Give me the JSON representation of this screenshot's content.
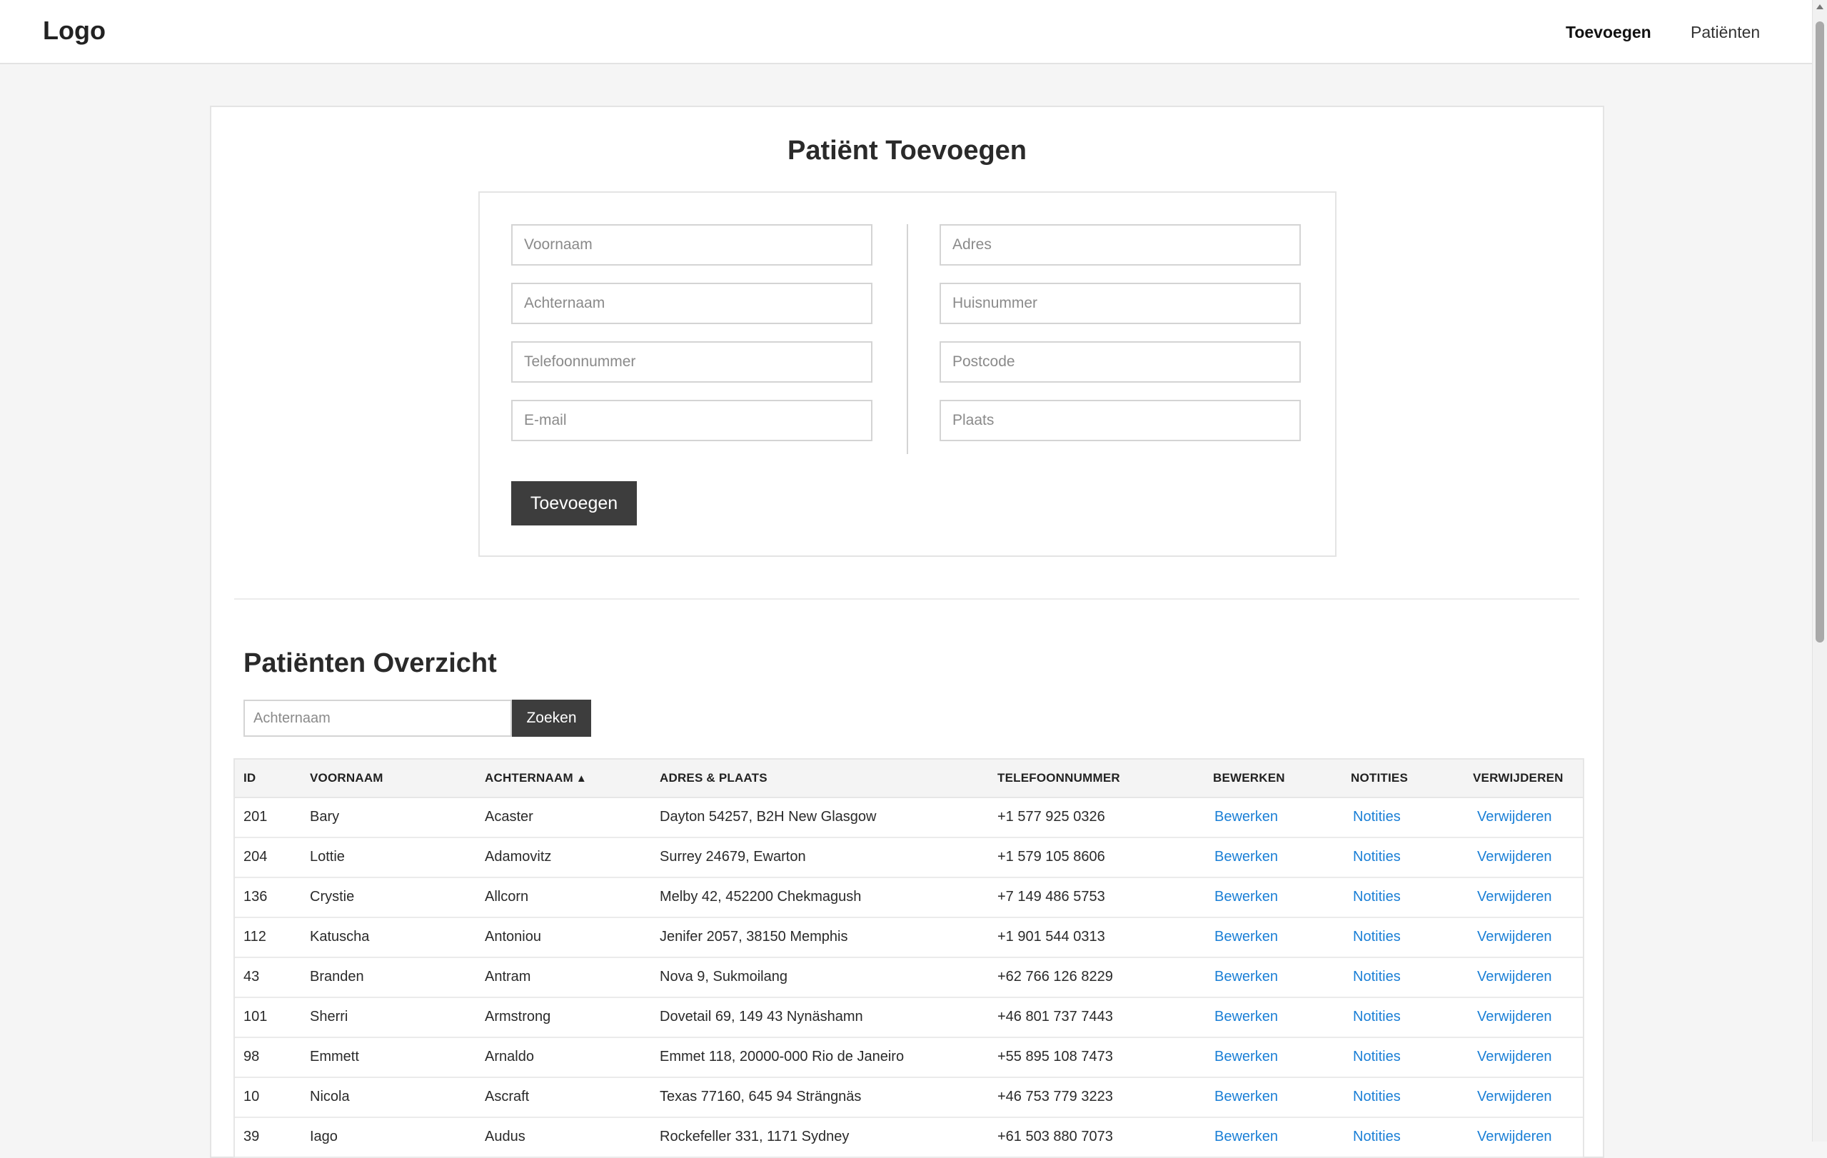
{
  "nav": {
    "logo": "Logo",
    "links": [
      "Toevoegen",
      "Patiënten"
    ]
  },
  "form": {
    "title": "Patiënt Toevoegen",
    "placeholders": {
      "first_name": "Voornaam",
      "last_name": "Achternaam",
      "phone": "Telefoonnummer",
      "email": "E-mail",
      "address": "Adres",
      "house_number": "Huisnummer",
      "postcode": "Postcode",
      "city": "Plaats"
    },
    "submit_label": "Toevoegen"
  },
  "overview": {
    "title": "Patiënten Overzicht",
    "search_placeholder": "Achternaam",
    "search_button": "Zoeken",
    "columns": [
      "ID",
      "VOORNAAM",
      "ACHTERNAAM",
      "ADRES & PLAATS",
      "TELEFOONNUMMER",
      "BEWERKEN",
      "NOTITIES",
      "VERWIJDEREN"
    ],
    "sort_indicator": "▲",
    "action_labels": {
      "edit": "Bewerken",
      "notes": "Notities",
      "delete": "Verwijderen"
    },
    "rows": [
      [
        "201",
        "Bary",
        "Acaster",
        "Dayton 54257, B2H New Glasgow",
        "+1 577 925 0326"
      ],
      [
        "204",
        "Lottie",
        "Adamovitz",
        "Surrey 24679, Ewarton",
        "+1 579 105 8606"
      ],
      [
        "136",
        "Crystie",
        "Allcorn",
        "Melby 42, 452200 Chekmagush",
        "+7 149 486 5753"
      ],
      [
        "112",
        "Katuscha",
        "Antoniou",
        "Jenifer 2057, 38150 Memphis",
        "+1 901 544 0313"
      ],
      [
        "43",
        "Branden",
        "Antram",
        "Nova 9, Sukmoilang",
        "+62 766 126 8229"
      ],
      [
        "101",
        "Sherri",
        "Armstrong",
        "Dovetail 69, 149 43 Nynäshamn",
        "+46 801 737 7443"
      ],
      [
        "98",
        "Emmett",
        "Arnaldo",
        "Emmet 118, 20000-000 Rio de Janeiro",
        "+55 895 108 7473"
      ],
      [
        "10",
        "Nicola",
        "Ascraft",
        "Texas 77160, 645 94 Strängnäs",
        "+46 753 779 3223"
      ],
      [
        "39",
        "Iago",
        "Audus",
        "Rockefeller 331, 1171 Sydney",
        "+61 503 880 7073"
      ]
    ]
  }
}
